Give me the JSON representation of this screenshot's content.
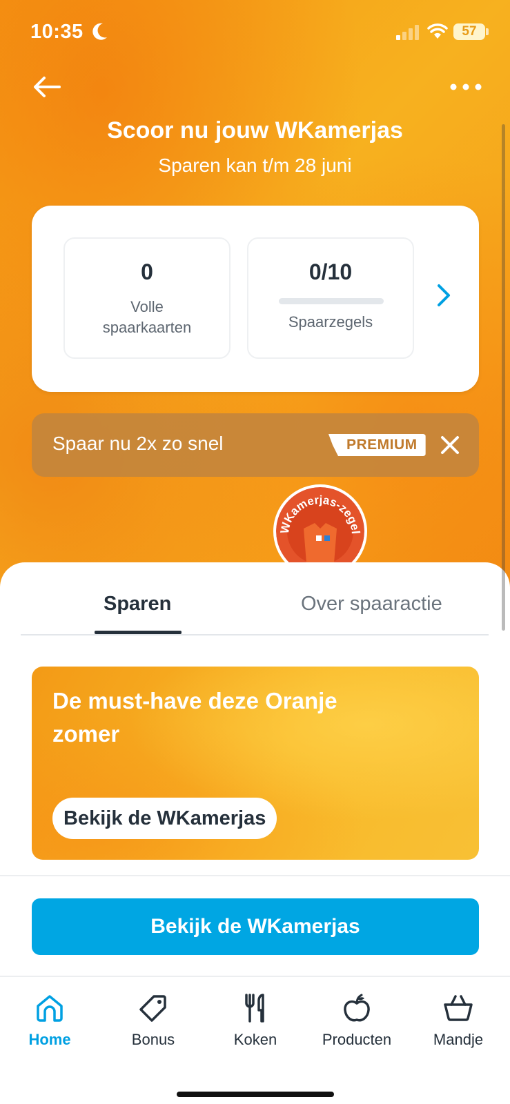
{
  "status_bar": {
    "time": "10:35",
    "battery": "57",
    "icons": [
      "moon-icon",
      "signal-icon",
      "wifi-icon",
      "battery-icon"
    ]
  },
  "header": {
    "title": "Scoor nu jouw WKamerjas",
    "subtitle": "Sparen kan t/m 28 juni"
  },
  "savings_card": {
    "full_cards": {
      "value": "0",
      "label": "Volle spaarkaarten"
    },
    "stamps": {
      "value": "0/10",
      "label": "Spaarzegels",
      "progress_fraction": 0
    }
  },
  "premium_banner": {
    "text": "Spaar nu 2x zo snel",
    "badge": "PREMIUM"
  },
  "sticker": {
    "text": "WKamerjas-zegel"
  },
  "tabs": [
    {
      "label": "Sparen",
      "active": true
    },
    {
      "label": "Over spaaractie",
      "active": false
    }
  ],
  "promo": {
    "title": "De must-have deze Oranje zomer",
    "button_label": "Bekijk de WKamerjas"
  },
  "cta": {
    "label": "Bekijk de WKamerjas"
  },
  "bottom_nav": [
    {
      "label": "Home",
      "icon": "home-icon",
      "active": true
    },
    {
      "label": "Bonus",
      "icon": "tag-icon",
      "active": false
    },
    {
      "label": "Koken",
      "icon": "cutlery-icon",
      "active": false
    },
    {
      "label": "Producten",
      "icon": "apple-icon",
      "active": false
    },
    {
      "label": "Mandje",
      "icon": "basket-icon",
      "active": false
    }
  ],
  "colors": {
    "accent_blue": "#00a6e3",
    "hero_orange": "#f59a14",
    "text_dark": "#25303b",
    "premium_brown": "#c4853c"
  }
}
